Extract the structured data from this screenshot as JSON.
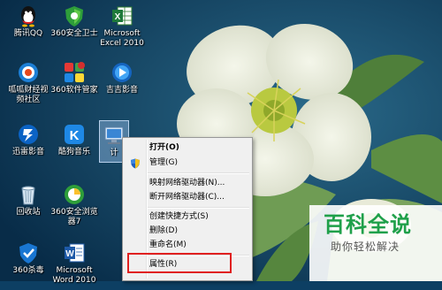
{
  "desktop": {
    "icons": [
      {
        "label": "腾讯QQ",
        "icon": "qq-icon"
      },
      {
        "label": "360安全卫士",
        "icon": "360-security-icon"
      },
      {
        "label": "Microsoft\nExcel 2010",
        "icon": "excel-icon"
      },
      {
        "label": "呱呱财经视\n频社区",
        "icon": "guagua-icon"
      },
      {
        "label": "360软件管家",
        "icon": "360-software-manager-icon"
      },
      {
        "label": "吉吉影音",
        "icon": "jiji-player-icon"
      },
      {
        "label": "迅雷影音",
        "icon": "xunlei-player-icon"
      },
      {
        "label": "酷狗音乐",
        "icon": "kugou-music-icon"
      },
      {
        "label": "计",
        "icon": "computer-icon"
      },
      {
        "label": "回收站",
        "icon": "recycle-bin-icon"
      },
      {
        "label": "360安全浏览\n器7",
        "icon": "360-browser-icon"
      },
      {
        "label": "360杀毒",
        "icon": "360-antivirus-icon"
      },
      {
        "label": "Microsoft\nWord 2010",
        "icon": "word-icon"
      }
    ]
  },
  "context_menu": {
    "items": [
      {
        "label": "打开(O)",
        "bold": true
      },
      {
        "label": "管理(G)",
        "icon": "uac-shield-icon"
      },
      {
        "label": "映射网络驱动器(N)..."
      },
      {
        "label": "断开网络驱动器(C)..."
      },
      {
        "label": "创建快捷方式(S)"
      },
      {
        "label": "删除(D)"
      },
      {
        "label": "重命名(M)"
      },
      {
        "label": "属性(R)",
        "highlighted": true
      }
    ]
  },
  "watermark": {
    "title": "百科全说",
    "subtitle": "助你轻松解决"
  },
  "colors": {
    "highlight_border": "#e02020",
    "watermark_green": "#1fa04a"
  }
}
